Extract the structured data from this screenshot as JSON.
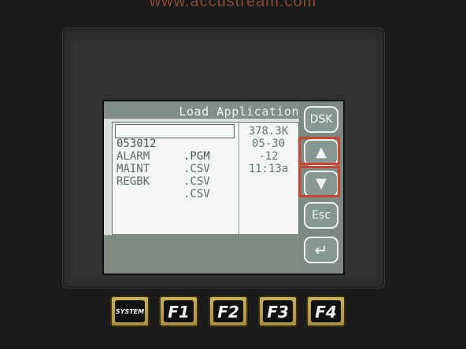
{
  "brand": {
    "url": "www.accustream.com"
  },
  "screen": {
    "title": "Load Application",
    "files": [
      {
        "name": "053012",
        "ext": ".PGM",
        "selected": true
      },
      {
        "name": "ALARM",
        "ext": ".CSV",
        "selected": false
      },
      {
        "name": "MAINT",
        "ext": ".CSV",
        "selected": false
      },
      {
        "name": "REGBK",
        "ext": ".CSV",
        "selected": false
      }
    ],
    "info": [
      "378.3K",
      "05-30",
      "-12",
      "11:13a"
    ],
    "buttons": {
      "dsk": "DSK",
      "up": "▲",
      "down": "▼",
      "esc": "Esc",
      "enter": "↵"
    }
  },
  "keys": {
    "system": "SYSTEM",
    "f1": "F1",
    "f2": "F2",
    "f3": "F3",
    "f4": "F4"
  },
  "colors": {
    "highlight": "#c8452e",
    "screen": "#d9dedb",
    "key_gold": "#c8b15c"
  }
}
